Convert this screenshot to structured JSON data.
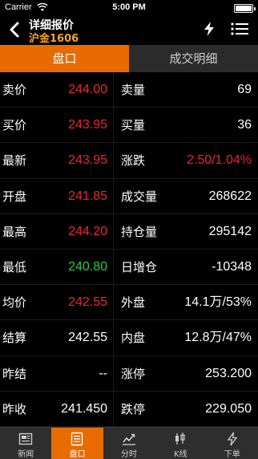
{
  "status_bar": {
    "carrier": "Carrier",
    "time": "5:00 PM"
  },
  "nav": {
    "title": "详细报价",
    "subtitle": "沪金1606"
  },
  "tabs": {
    "active": "盘口",
    "inactive": "成交明细"
  },
  "colors": {
    "accent": "#e86b00",
    "up": "#e8282f",
    "down": "#22d13a",
    "subtitle": "#f5a623"
  },
  "quote": {
    "rows": [
      {
        "l1": "卖价",
        "v1": "244.00",
        "c1": "red",
        "l2": "卖量",
        "v2": "69",
        "c2": "white"
      },
      {
        "l1": "买价",
        "v1": "243.95",
        "c1": "red",
        "l2": "买量",
        "v2": "36",
        "c2": "white"
      },
      {
        "l1": "最新",
        "v1": "243.95",
        "c1": "red",
        "l2": "涨跌",
        "v2": "2.50/1.04%",
        "c2": "red"
      },
      {
        "l1": "开盘",
        "v1": "241.85",
        "c1": "red",
        "l2": "成交量",
        "v2": "268622",
        "c2": "white"
      },
      {
        "l1": "最高",
        "v1": "244.20",
        "c1": "red",
        "l2": "持仓量",
        "v2": "295142",
        "c2": "white"
      },
      {
        "l1": "最低",
        "v1": "240.80",
        "c1": "green",
        "l2": "日增仓",
        "v2": "-10348",
        "c2": "white"
      },
      {
        "l1": "均价",
        "v1": "242.55",
        "c1": "red",
        "l2": "外盘",
        "v2": "14.1万/53%",
        "c2": "white"
      },
      {
        "l1": "结算",
        "v1": "242.55",
        "c1": "white",
        "l2": "内盘",
        "v2": "12.8万/47%",
        "c2": "white"
      },
      {
        "l1": "昨结",
        "v1": "--",
        "c1": "white",
        "l2": "涨停",
        "v2": "253.200",
        "c2": "white"
      },
      {
        "l1": "昨收",
        "v1": "241.450",
        "c1": "white",
        "l2": "跌停",
        "v2": "229.050",
        "c2": "white"
      }
    ]
  },
  "tab_bar": {
    "items": [
      {
        "label": "新闻",
        "icon": "news-icon"
      },
      {
        "label": "盘口",
        "icon": "orderbook-icon"
      },
      {
        "label": "分时",
        "icon": "timeshare-chart-icon"
      },
      {
        "label": "K线",
        "icon": "candlestick-icon"
      },
      {
        "label": "下单",
        "icon": "order-icon"
      }
    ]
  }
}
